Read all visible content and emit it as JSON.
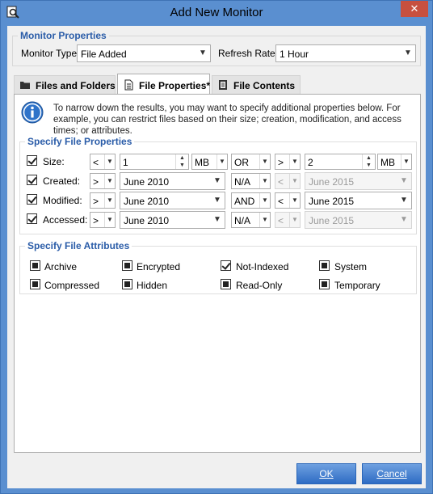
{
  "window": {
    "title": "Add New Monitor"
  },
  "monitor_properties": {
    "title": "Monitor Properties",
    "type_label": "Monitor Type:",
    "type_value": "File Added",
    "refresh_label": "Refresh Rate:",
    "refresh_value": "1 Hour"
  },
  "tabs": [
    {
      "label": "Files and Folders",
      "icon": "folder-icon"
    },
    {
      "label": "File Properties*",
      "icon": "document-icon"
    },
    {
      "label": "File Contents",
      "icon": "file-contents-icon"
    }
  ],
  "info": {
    "text": "To narrow down the results, you may want to specify additional properties below. For example, you can restrict files based on their size; creation, modification, and access times; or attributes."
  },
  "file_properties": {
    "title": "Specify File Properties",
    "rows": [
      {
        "label": "Size:",
        "checked": true,
        "op1": "<",
        "val1": "1",
        "unit1": "MB",
        "logic": "OR",
        "op2": ">",
        "val2": "2",
        "unit2": "MB"
      },
      {
        "label": "Created:",
        "checked": true,
        "op1": ">",
        "val1": "June 2010",
        "logic": "N/A",
        "op2": "<",
        "val2": "June 2015"
      },
      {
        "label": "Modified:",
        "checked": true,
        "op1": ">",
        "val1": "June 2010",
        "logic": "AND",
        "op2": "<",
        "val2": "June 2015"
      },
      {
        "label": "Accessed:",
        "checked": true,
        "op1": ">",
        "val1": "June 2010",
        "logic": "N/A",
        "op2": "<",
        "val2": "June 2015"
      }
    ]
  },
  "file_attributes": {
    "title": "Specify File Attributes",
    "items": [
      {
        "label": "Archive",
        "state": "indeterminate"
      },
      {
        "label": "Encrypted",
        "state": "indeterminate"
      },
      {
        "label": "Not-Indexed",
        "state": "checked"
      },
      {
        "label": "System",
        "state": "indeterminate"
      },
      {
        "label": "Compressed",
        "state": "indeterminate"
      },
      {
        "label": "Hidden",
        "state": "indeterminate"
      },
      {
        "label": "Read-Only",
        "state": "indeterminate"
      },
      {
        "label": "Temporary",
        "state": "indeterminate"
      }
    ]
  },
  "buttons": {
    "ok": "OK",
    "cancel": "Cancel"
  }
}
